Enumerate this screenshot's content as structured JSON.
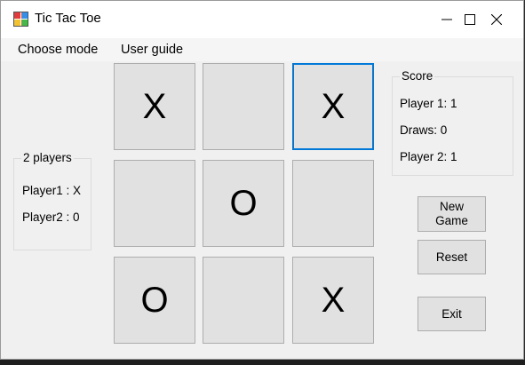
{
  "window": {
    "title": "Tic Tac Toe",
    "icon": "app-icon",
    "controls": [
      "minimize-icon",
      "maximize-icon",
      "close-icon"
    ]
  },
  "menu": {
    "items": [
      "Choose mode",
      "User guide"
    ]
  },
  "board": {
    "cells": [
      "X",
      "",
      "X",
      "",
      "O",
      "",
      "O",
      "",
      "X"
    ],
    "focused_cell": 2,
    "focus_color": "#0078d7"
  },
  "players": {
    "legend": "2 players",
    "player1": "Player1 :  X",
    "player2": "Player2 :  0"
  },
  "score": {
    "legend": "Score",
    "player1": "Player 1: 1",
    "draws": "Draws: 0",
    "player2": "Player 2: 1"
  },
  "buttons": {
    "new_game_line1": "New",
    "new_game_line2": "Game",
    "reset": "Reset",
    "exit": "Exit"
  }
}
